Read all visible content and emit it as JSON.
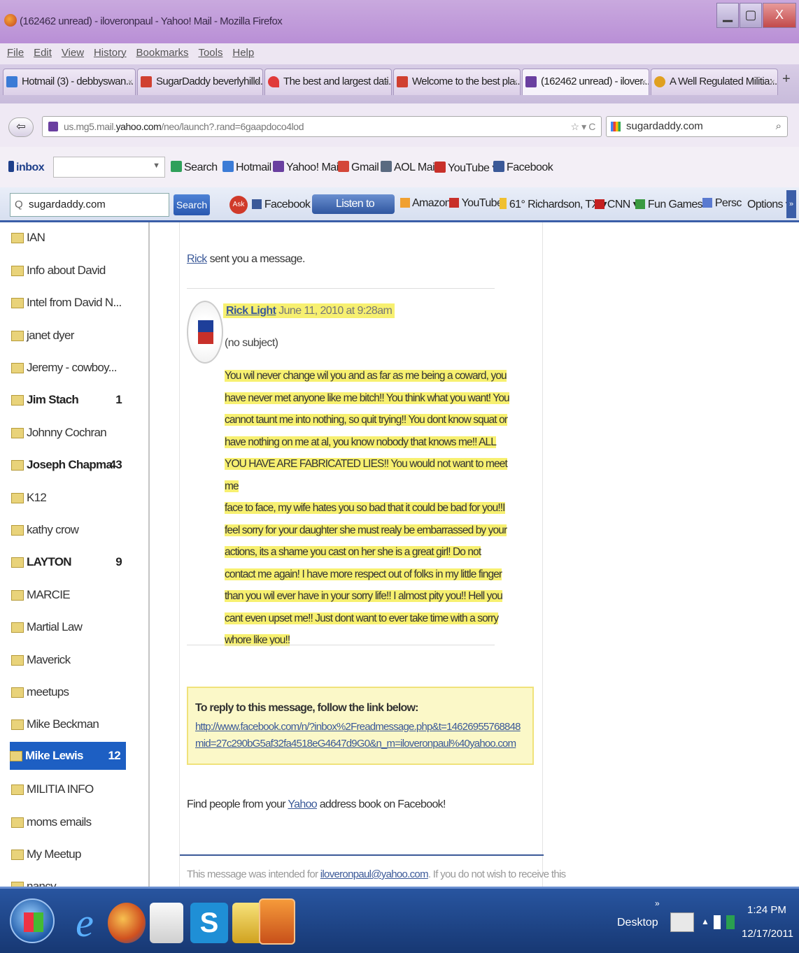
{
  "window": {
    "title": "(162462 unread) - iloveronpaul - Yahoo! Mail - Mozilla Firefox"
  },
  "menu": [
    "File",
    "Edit",
    "View",
    "History",
    "Bookmarks",
    "Tools",
    "Help"
  ],
  "tabs": [
    {
      "label": "Hotmail (3) - debbyswan...",
      "color": "#3b7bd6"
    },
    {
      "label": "SugarDaddy beverlyhilld...",
      "color": "#d04030"
    },
    {
      "label": "The best and largest dati...",
      "color": "#e03a3a"
    },
    {
      "label": "Welcome to the best pla...",
      "color": "#d04030"
    },
    {
      "label": "(162462 unread) - ilover...",
      "color": "#6a3fa0"
    },
    {
      "label": "A Well Regulated Militia:...",
      "color": "#e0a020"
    }
  ],
  "nav": {
    "url_host": "us.mg5.mail.",
    "url_domain": "yahoo.com",
    "url_path": "/neo/launch?.rand=6gaapdoco4lod",
    "search_value": "sugardaddy.com"
  },
  "bookmarks1": {
    "inbox_label": "inbox",
    "items": [
      "Search",
      "Hotmail",
      "Yahoo! Mail",
      "Gmail",
      "AOL Mail",
      "YouTube",
      "Facebook"
    ]
  },
  "toolbar2": {
    "search_value": "sugardaddy.com",
    "search_button": "Search",
    "facebook": "Facebook",
    "listen": "Listen to",
    "amazon": "Amazon",
    "youtube": "YouTube",
    "weather": "61° Richardson, TX",
    "cnn": "CNN",
    "fungames": "Fun Games",
    "perso": "Persc",
    "options": "Options"
  },
  "folders": [
    {
      "name": "IAN",
      "count": "",
      "bold": false,
      "selected": false
    },
    {
      "name": "Info about David",
      "count": "",
      "bold": false,
      "selected": false
    },
    {
      "name": "Intel from David N...",
      "count": "",
      "bold": false,
      "selected": false
    },
    {
      "name": "janet dyer",
      "count": "",
      "bold": false,
      "selected": false
    },
    {
      "name": "Jeremy - cowboy...",
      "count": "",
      "bold": false,
      "selected": false
    },
    {
      "name": "Jim Stach",
      "count": "1",
      "bold": true,
      "selected": false
    },
    {
      "name": "Johnny Cochran",
      "count": "",
      "bold": false,
      "selected": false
    },
    {
      "name": "Joseph Chapma",
      "count": "43",
      "bold": true,
      "selected": false
    },
    {
      "name": "K12",
      "count": "",
      "bold": false,
      "selected": false
    },
    {
      "name": "kathy crow",
      "count": "",
      "bold": false,
      "selected": false
    },
    {
      "name": "LAYTON",
      "count": "9",
      "bold": true,
      "selected": false
    },
    {
      "name": "MARCIE",
      "count": "",
      "bold": false,
      "selected": false
    },
    {
      "name": "Martial Law",
      "count": "",
      "bold": false,
      "selected": false
    },
    {
      "name": "Maverick",
      "count": "",
      "bold": false,
      "selected": false
    },
    {
      "name": "meetups",
      "count": "",
      "bold": false,
      "selected": false
    },
    {
      "name": "Mike Beckman",
      "count": "",
      "bold": false,
      "selected": false
    },
    {
      "name": "Mike Lewis",
      "count": "12",
      "bold": true,
      "selected": true
    },
    {
      "name": "MILITIA INFO",
      "count": "",
      "bold": false,
      "selected": false
    },
    {
      "name": "moms emails",
      "count": "",
      "bold": false,
      "selected": false
    },
    {
      "name": "My Meetup",
      "count": "",
      "bold": false,
      "selected": false
    },
    {
      "name": "nancy",
      "count": "",
      "bold": false,
      "selected": false
    }
  ],
  "message": {
    "intro_link": "Rick",
    "intro_rest": " sent you a message.",
    "sender": "Rick Light",
    "date": "June 11, 2010 at 9:28am",
    "subject": "(no subject)",
    "body": [
      "You wil never change wil you and as far as me being a coward, you",
      "have never met anyone like me bitch!! You think what you want! You",
      "cannot taunt me into nothing, so quit trying!! You dont know squat or",
      "have nothing on me at al, you know nobody that knows me!! ALL",
      "YOU HAVE ARE FABRICATED LIES!! You would not want to meet me",
      "face to face, my wife hates you so bad that it could be bad for you!!I",
      "feel sorry for your daughter she must realy be embarrassed by your",
      "actions, its a shame you cast on her she is a great girl! Do not",
      "contact me again! I have more respect out of folks in my little finger",
      "than you wil ever have in your sorry life!! I almost pity you!! Hell you",
      "cant even upset me!! Just dont want to ever take time with a sorry",
      "whore like you!!"
    ],
    "reply_heading": "To reply to this message, follow the link below:",
    "reply_link_1": "http://www.facebook.com/n/?inbox%2Freadmessage.php&t=14626955768848",
    "reply_link_2": "mid=27c290bG5af32fa4518eG4647d9G0&n_m=iloveronpaul%40yahoo.com",
    "find_pre": "Find people from your ",
    "find_link": "Yahoo",
    "find_post": " address book on Facebook!",
    "footer_pre": "This message was intended for ",
    "footer_email": "iloveronpaul@yahoo.com",
    "footer_post": ". If you do not wish to receive this"
  },
  "taskbar": {
    "desktop": "Desktop",
    "time": "1:24 PM",
    "date": "12/17/2011"
  }
}
